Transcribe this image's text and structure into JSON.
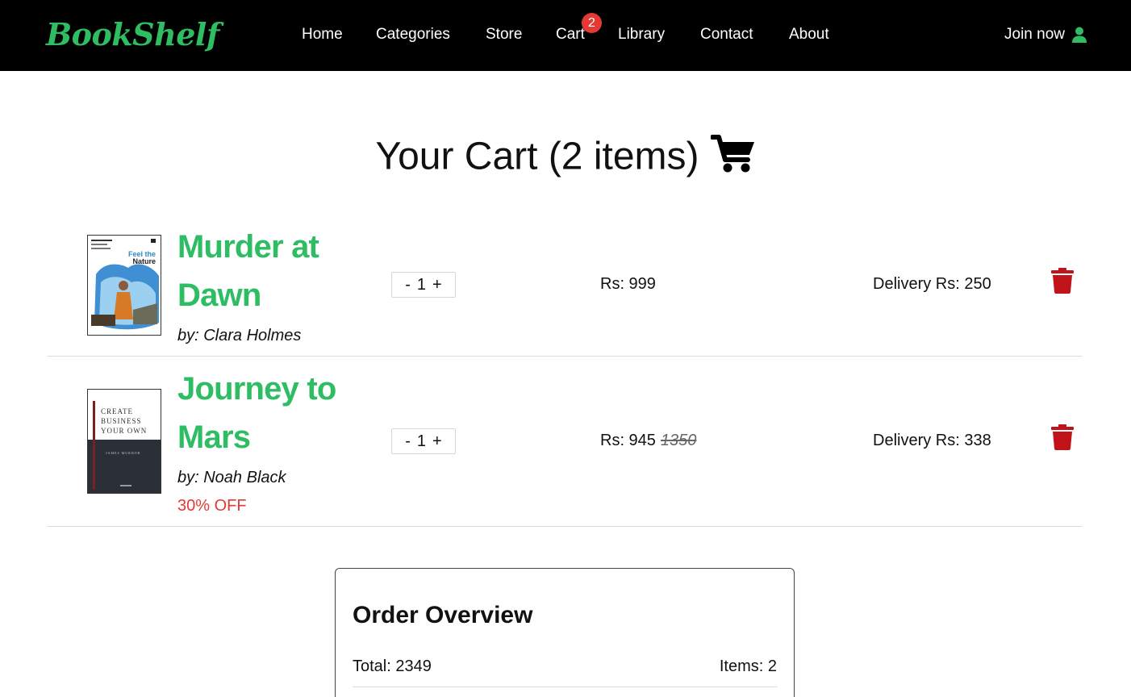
{
  "navbar": {
    "brand": "BookShelf",
    "links": [
      "Home",
      "Categories",
      "Store",
      "Cart",
      "Library",
      "Contact",
      "About"
    ],
    "cart_count": "2",
    "join_label": "Join now"
  },
  "cart": {
    "title": "Your Cart (2 items)",
    "items": [
      {
        "title": "Murder at Dawn",
        "author": "by: Clara Holmes",
        "qty_minus": "-",
        "qty": "1",
        "qty_plus": "+",
        "price": "Rs: 999",
        "old_price": "",
        "delivery": "Delivery Rs: 250",
        "discount": "",
        "cover_text": [
          "Feel the",
          "Nature"
        ]
      },
      {
        "title": "Journey to Mars",
        "author": "by: Noah Black",
        "qty_minus": "-",
        "qty": "1",
        "qty_plus": "+",
        "price": "Rs: 945",
        "old_price": "1350",
        "delivery": "Delivery Rs: 338",
        "discount": "30% OFF",
        "cover_text": [
          "CREATE",
          "BUSINESS",
          "YOUR OWN",
          "JAMES MURDOR"
        ]
      }
    ]
  },
  "overview": {
    "title": "Order Overview",
    "total": "Total: 2349",
    "items": "Items: 2"
  },
  "colors": {
    "brand_green": "#2ebd63",
    "badge_red": "#e53935",
    "trash_red": "#c0141a",
    "navbar_bg": "#000000"
  },
  "icons": [
    "user-icon",
    "cart-icon",
    "trash-icon"
  ]
}
